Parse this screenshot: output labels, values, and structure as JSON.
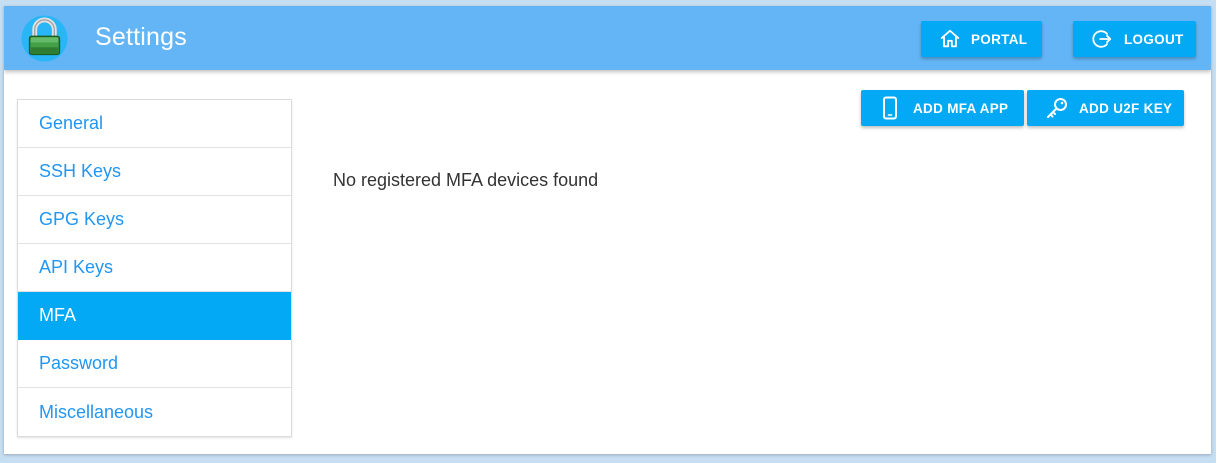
{
  "header": {
    "title": "Settings",
    "logo_icon": "padlock-icon",
    "portal_label": "PORTAL",
    "logout_label": "LOGOUT"
  },
  "sidebar": {
    "items": [
      {
        "label": "General",
        "active": false
      },
      {
        "label": "SSH Keys",
        "active": false
      },
      {
        "label": "GPG Keys",
        "active": false
      },
      {
        "label": "API Keys",
        "active": false
      },
      {
        "label": "MFA",
        "active": true
      },
      {
        "label": "Password",
        "active": false
      },
      {
        "label": "Miscellaneous",
        "active": false
      }
    ]
  },
  "main": {
    "add_mfa_app_label": "ADD MFA APP",
    "add_u2f_key_label": "ADD U2F KEY",
    "empty_message": "No registered MFA devices found"
  },
  "colors": {
    "header_bg": "#64b5f6",
    "accent": "#03a9f4",
    "link": "#2196f3"
  }
}
